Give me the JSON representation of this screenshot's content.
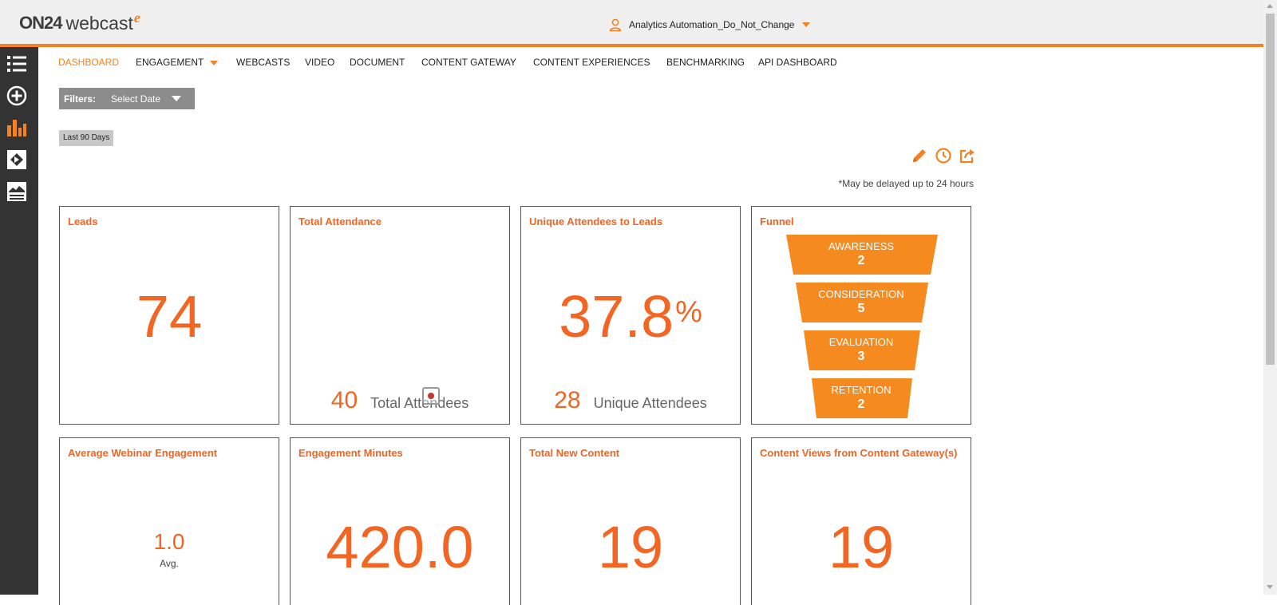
{
  "app": {
    "logo_text": "ON24",
    "logo_product": "webcast",
    "logo_suffix": "e",
    "account_name": "Analytics Automation_Do_Not_Change"
  },
  "sidebar": {
    "items": [
      {
        "icon": "list-icon",
        "active": false
      },
      {
        "icon": "add-circle-icon",
        "active": false
      },
      {
        "icon": "bar-chart-icon",
        "active": true
      },
      {
        "icon": "media-frame-icon",
        "active": false
      },
      {
        "icon": "landscape-panel-icon",
        "active": false
      }
    ]
  },
  "nav": {
    "items": [
      {
        "label": "DASHBOARD",
        "active": true
      },
      {
        "label": "ENGAGEMENT",
        "dropdown": true
      },
      {
        "label": "WEBCASTS"
      },
      {
        "label": "VIDEO"
      },
      {
        "label": "DOCUMENT"
      },
      {
        "label": "CONTENT GATEWAY"
      },
      {
        "label": "CONTENT EXPERIENCES"
      },
      {
        "label": "BENCHMARKING"
      },
      {
        "label": "API DASHBOARD"
      }
    ]
  },
  "filters": {
    "label": "Filters:",
    "select_value": "Select Date",
    "active_range": "Last 90 Days"
  },
  "tools": {
    "icons": [
      "pencil-icon",
      "clock-icon",
      "share-icon"
    ],
    "note": "*May be delayed up to 24 hours"
  },
  "cards": {
    "leads": {
      "title": "Leads",
      "value": "74"
    },
    "total_attendance": {
      "title": "Total Attendance",
      "count": "40",
      "count_label": "Total Attendees"
    },
    "unique_to_leads": {
      "title": "Unique Attendees to Leads",
      "value": "37.8",
      "unit": "%",
      "count": "28",
      "count_label": "Unique Attendees"
    },
    "funnel": {
      "title": "Funnel",
      "steps": [
        {
          "label": "AWARENESS",
          "value": "2"
        },
        {
          "label": "CONSIDERATION",
          "value": "5"
        },
        {
          "label": "EVALUATION",
          "value": "3"
        },
        {
          "label": "RETENTION",
          "value": "2"
        }
      ]
    },
    "avg_engagement": {
      "title": "Average Webinar Engagement",
      "value": "1.0",
      "unit_label": "Avg."
    },
    "engagement_minutes": {
      "title": "Engagement Minutes",
      "value": "420.0"
    },
    "total_new_content": {
      "title": "Total New Content",
      "value": "19"
    },
    "gateway_views": {
      "title": "Content Views from Content Gateway(s)",
      "value": "19"
    }
  },
  "colors": {
    "accent": "#f26522",
    "header_bar": "#f58220",
    "sidebar_bg": "#333333",
    "funnel_fill": "#f58a1f"
  }
}
